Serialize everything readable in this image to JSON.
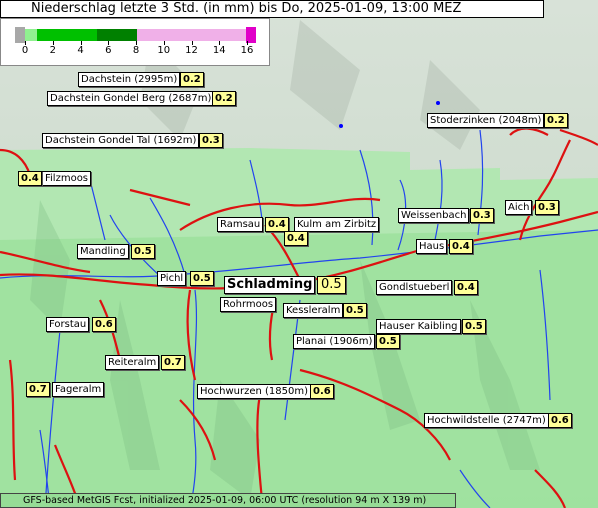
{
  "title": "Niederschlag letzte 3 Std. (in mm) bis Do, 2025-01-09, 13:00 MEZ",
  "legend": {
    "ticks": [
      "0",
      "2",
      "4",
      "6",
      "8",
      "10",
      "12",
      "14",
      "16"
    ],
    "colors": {
      "below_min": "#a8a8a8",
      "light_green": "#90f090",
      "green": "#00c000",
      "dark_green": "#007000",
      "pink": "#f0b0e8",
      "above_max": "#e000c8"
    }
  },
  "stations": [
    {
      "name": "Dachstein (2995m)",
      "value": "0.2"
    },
    {
      "name": "Dachstein Gondel Berg (2687m)",
      "value": "0.2"
    },
    {
      "name": "Dachstein Gondel Tal (1692m)",
      "value": "0.3"
    },
    {
      "name": "Filzmoos",
      "value": "0.4"
    },
    {
      "name": "Stoderzinken (2048m)",
      "value": "0.2"
    },
    {
      "name": "Ramsau",
      "value": "0.4"
    },
    {
      "name": "Kulm am Zirbitz",
      "value": "0.4"
    },
    {
      "name": "Weissenbach",
      "value": "0.3"
    },
    {
      "name": "Aich",
      "value": "0.3"
    },
    {
      "name": "Mandling",
      "value": "0.5"
    },
    {
      "name": "Haus",
      "value": "0.4"
    },
    {
      "name": "Pichl",
      "value": "0.5"
    },
    {
      "name": "Schladming",
      "value": "0.5"
    },
    {
      "name": "Gondlstueberl",
      "value": "0.4"
    },
    {
      "name": "Rohrmoos",
      "value": ""
    },
    {
      "name": "Kessleralm",
      "value": "0.5"
    },
    {
      "name": "Forstau",
      "value": "0.6"
    },
    {
      "name": "Hauser Kaibling",
      "value": "0.5"
    },
    {
      "name": "Planai (1906m)",
      "value": "0.5"
    },
    {
      "name": "Reiteralm",
      "value": "0.7"
    },
    {
      "name": "Fageralm",
      "value": "0.7"
    },
    {
      "name": "Hochwurzen (1850m)",
      "value": "0.6"
    },
    {
      "name": "Hochwildstelle (2747m)",
      "value": "0.6"
    }
  ],
  "footer": "GFS-based MetGIS Fcst, initialized 2025-01-09, 06:00 UTC  (resolution 94 m X 139 m)"
}
